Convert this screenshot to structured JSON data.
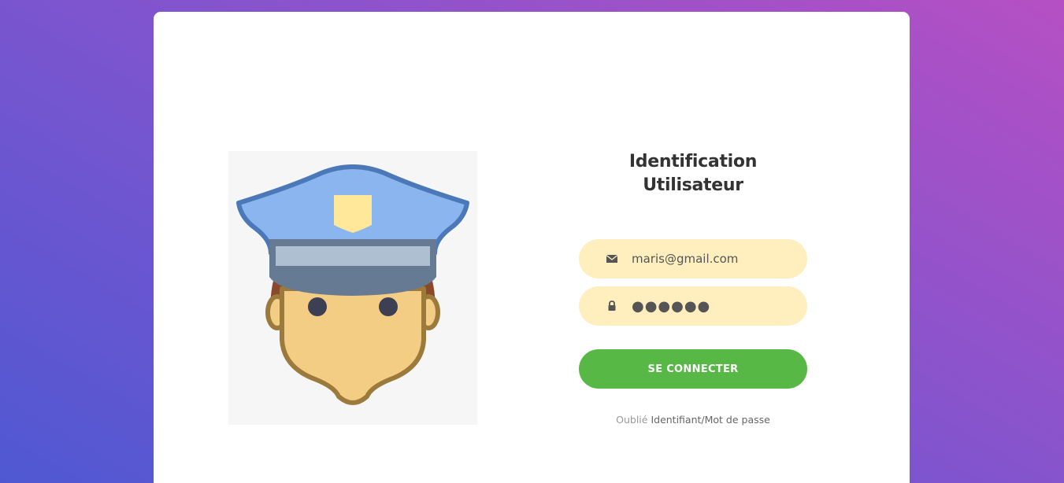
{
  "login": {
    "title_line1": "Identification",
    "title_line2": "Utilisateur",
    "email": {
      "value": "maris@gmail.com",
      "icon": "envelope-icon"
    },
    "password": {
      "value": "●●●●●●",
      "icon": "lock-icon"
    },
    "submit_label": "SE CONNECTER",
    "forgot_prefix": "Oublié",
    "forgot_link": "Identifiant/Mot de passe"
  },
  "illustration": {
    "subject": "police-officer-avatar"
  },
  "colors": {
    "gradient_start": "#4f58d2",
    "gradient_end": "#b64fc4",
    "field_bg": "#ffefbe",
    "button_green": "#57b846",
    "title_text": "#333333"
  }
}
